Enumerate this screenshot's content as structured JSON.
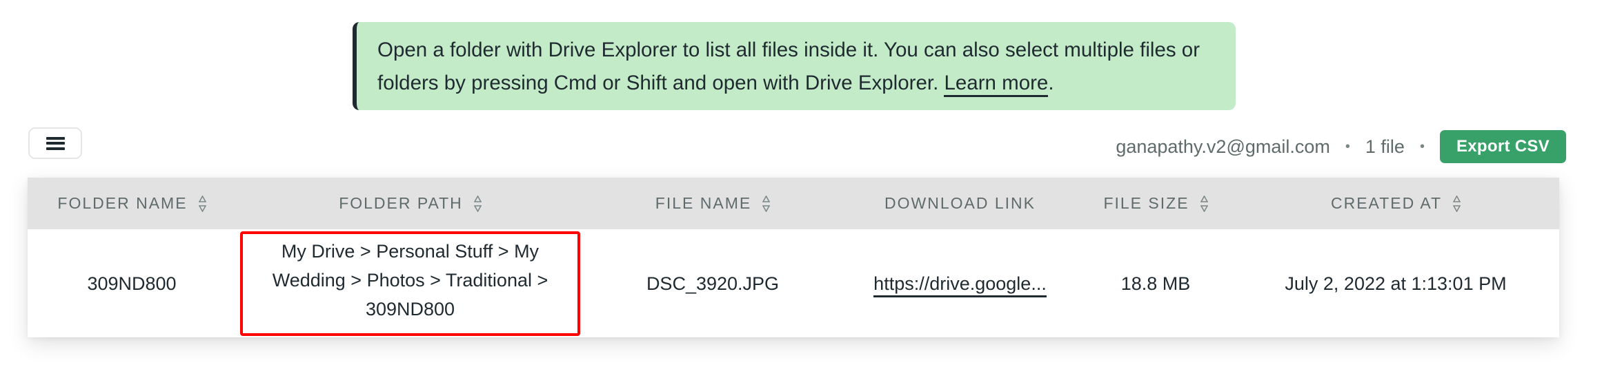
{
  "banner": {
    "text": "Open a folder with Drive Explorer to list all files inside it. You can also select multiple files or folders by pressing Cmd or Shift and open with Drive Explorer. ",
    "link_label": "Learn more",
    "trailing": "."
  },
  "toolbar": {
    "menu_icon": "hamburger-menu-icon",
    "account_email": "ganapathy.v2@gmail.com",
    "separator": "•",
    "file_count": "1 file",
    "export_label": "Export CSV"
  },
  "table": {
    "columns": [
      {
        "label": "FOLDER NAME",
        "sortable": true
      },
      {
        "label": "FOLDER PATH",
        "sortable": true
      },
      {
        "label": "FILE NAME",
        "sortable": true
      },
      {
        "label": "DOWNLOAD LINK",
        "sortable": false
      },
      {
        "label": "FILE SIZE",
        "sortable": true
      },
      {
        "label": "CREATED AT",
        "sortable": true
      }
    ],
    "rows": [
      {
        "folder_name": "309ND800",
        "folder_path": "My Drive > Personal Stuff > My Wedding > Photos > Traditional > 309ND800",
        "file_name": "DSC_3920.JPG",
        "download_link": "https://drive.google...",
        "file_size": "18.8 MB",
        "created_at": "July 2, 2022 at 1:13:01 PM"
      }
    ]
  },
  "colors": {
    "banner_bg": "#c3ebc8",
    "banner_accent": "#1f2a30",
    "export_button": "#38a169",
    "header_bg": "#e2e2e2",
    "highlight": "#ff0000"
  }
}
